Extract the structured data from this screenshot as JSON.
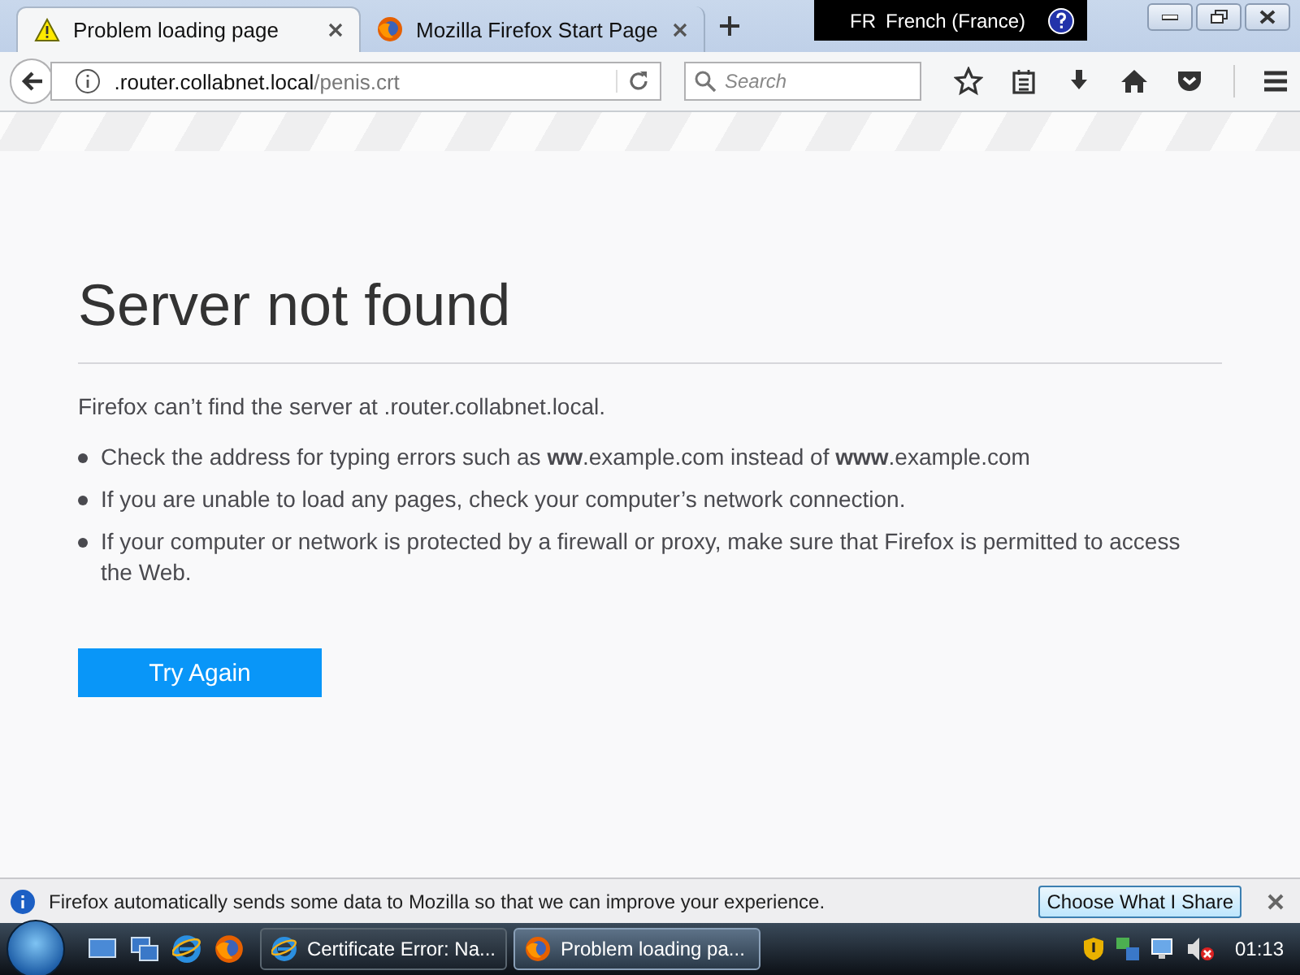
{
  "tabs": [
    {
      "title": "Problem loading page",
      "kind": "warning",
      "selected": true
    },
    {
      "title": "Mozilla Firefox Start Page",
      "kind": "firefox",
      "selected": false
    }
  ],
  "language_indicator": {
    "code": "FR",
    "name": "French (France)"
  },
  "address_bar": {
    "host": ".router.collabnet.local",
    "path": "/penis.crt"
  },
  "search": {
    "placeholder": "Search"
  },
  "error_page": {
    "title": "Server not found",
    "intro": "Firefox can’t find the server at .router.collabnet.local.",
    "bullets": [
      "Check the address for typing errors such as **ww**.example.com instead of **www**.example.com",
      "If you are unable to load any pages, check your computer’s network connection.",
      "If your computer or network is protected by a firewall or proxy, make sure that Firefox is permitted to access the Web."
    ],
    "button": "Try Again"
  },
  "notification_bar": {
    "text": "Firefox automatically sends some data to Mozilla so that we can improve your experience.",
    "button": "Choose What I Share"
  },
  "taskbar": {
    "items": [
      {
        "label": "Certificate Error: Na...",
        "kind": "ie",
        "selected": false
      },
      {
        "label": "Problem loading pa...",
        "kind": "firefox",
        "selected": true
      }
    ],
    "clock": "01:13"
  }
}
